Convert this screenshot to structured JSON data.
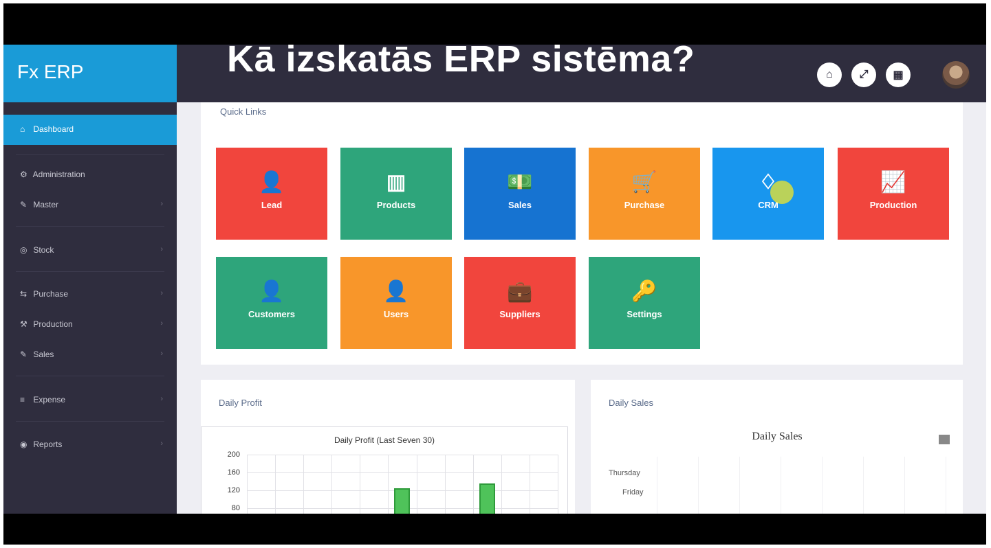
{
  "overlay_title": "Kā izskatās ERP sistēma?",
  "brand": "Fx ERP",
  "header_icons": [
    "home-icon",
    "expand-icon",
    "calendar-icon"
  ],
  "header_icon_glyphs": [
    "⌂",
    "⤢",
    "▦"
  ],
  "sidebar": {
    "items": [
      {
        "label": "Dashboard",
        "icon": "home-icon",
        "glyph": "⌂",
        "active": true
      },
      {
        "label": "Administration",
        "icon": "gear-icon",
        "glyph": "⚙"
      },
      {
        "label": "Master",
        "icon": "edit-icon",
        "glyph": "✎"
      },
      {
        "label": "Stock",
        "icon": "box-icon",
        "glyph": "◎"
      },
      {
        "label": "Purchase",
        "icon": "cart-icon",
        "glyph": "⇆"
      },
      {
        "label": "Production",
        "icon": "factory-icon",
        "glyph": "⚒"
      },
      {
        "label": "Sales",
        "icon": "tag-icon",
        "glyph": "✎"
      },
      {
        "label": "Expense",
        "icon": "wallet-icon",
        "glyph": "≡"
      },
      {
        "label": "Reports",
        "icon": "report-icon",
        "glyph": "◉"
      }
    ]
  },
  "quick_links": {
    "title": "Quick Links",
    "tiles": [
      {
        "label": "Lead",
        "icon": "user-icon",
        "glyph": "👤",
        "color": "#f1453d"
      },
      {
        "label": "Products",
        "icon": "barcode-icon",
        "glyph": "▥",
        "color": "#2ea57b"
      },
      {
        "label": "Sales",
        "icon": "money-icon",
        "glyph": "💵",
        "color": "#1673d1"
      },
      {
        "label": "Purchase",
        "icon": "cart-icon",
        "glyph": "🛒",
        "color": "#f8962a"
      },
      {
        "label": "CRM",
        "icon": "diamond-icon",
        "glyph": "♢",
        "color": "#1896ee"
      },
      {
        "label": "Production",
        "icon": "chart-icon",
        "glyph": "📈",
        "color": "#f1453d"
      },
      {
        "label": "Customers",
        "icon": "user-icon",
        "glyph": "👤",
        "color": "#2ea57b"
      },
      {
        "label": "Users",
        "icon": "user-icon",
        "glyph": "👤",
        "color": "#f8962a"
      },
      {
        "label": "Suppliers",
        "icon": "briefcase-icon",
        "glyph": "💼",
        "color": "#f1453d"
      },
      {
        "label": "Settings",
        "icon": "key-icon",
        "glyph": "🔑",
        "color": "#2ea57b"
      }
    ]
  },
  "daily_profit": {
    "panel_title": "Daily Profit",
    "chart_title": "Daily Profit (Last Seven 30)",
    "y_ticks": [
      "200",
      "160",
      "120",
      "80"
    ]
  },
  "daily_sales": {
    "panel_title": "Daily Sales",
    "chart_title": "Daily Sales",
    "row_labels": [
      "Thursday",
      "Friday"
    ]
  },
  "chart_data": [
    {
      "type": "bar",
      "title": "Daily Profit (Last Seven 30)",
      "ylim": [
        80,
        200
      ],
      "y_ticks": [
        200,
        160,
        120,
        80
      ],
      "x_count": 11,
      "bars": [
        {
          "index": 5,
          "value": 125
        },
        {
          "index": 8,
          "value": 135
        }
      ]
    }
  ]
}
